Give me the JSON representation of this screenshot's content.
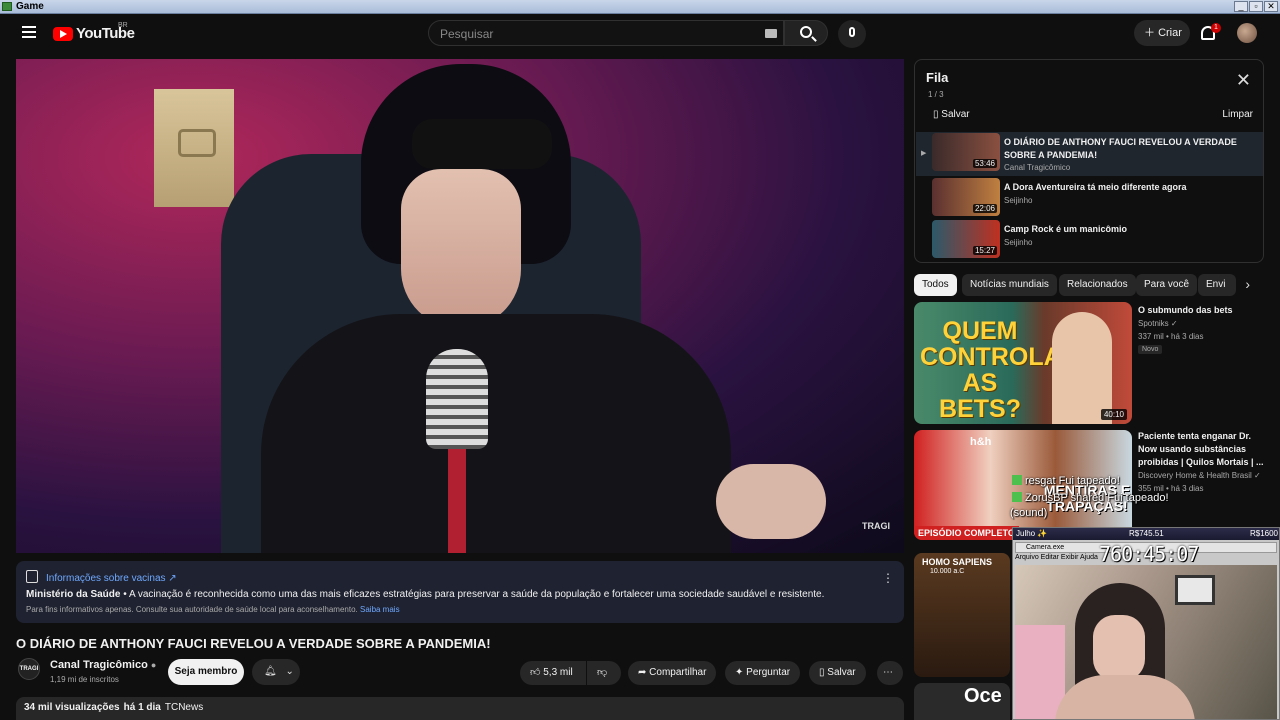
{
  "window": {
    "title": "Game",
    "buttons": [
      "_",
      "▫",
      "✕"
    ]
  },
  "header": {
    "logo_text": "YouTube",
    "logo_country": "BR",
    "search_placeholder": "Pesquisar",
    "create_label": "Criar",
    "notification_count": "1"
  },
  "player": {
    "watermark": "TRAGI"
  },
  "info_panel": {
    "title": "Informações sobre vacinas ↗",
    "source": "Ministério da Saúde",
    "text": " • A vacinação é reconhecida como uma das mais eficazes estratégias para preservar a saúde da população e fortalecer uma sociedade saudável e resistente.",
    "footnote": "Para fins informativos apenas. Consulte sua autoridade de saúde local para aconselhamento.",
    "footnote_link": "Saiba mais"
  },
  "video": {
    "title": "O DIÁRIO DE ANTHONY FAUCI REVELOU A VERDADE SOBRE A PANDEMIA!",
    "channel": "Canal Tragicômico",
    "channel_avatar_text": "TRAGI",
    "subscribers": "1,19 mi de inscritos",
    "member_label": "Seja membro",
    "likes": "5,3 mil",
    "share_label": "Compartilhar",
    "ask_label": "Perguntar",
    "save_label": "Salvar",
    "views": "34 mil visualizações",
    "age": "há 1 dia",
    "tag": "TCNews"
  },
  "queue": {
    "title": "Fila",
    "count": "1 / 3",
    "save_label": "Salvar",
    "clear_label": "Limpar",
    "items": [
      {
        "title": "O DIÁRIO DE ANTHONY FAUCI REVELOU A VERDADE SOBRE A PANDEMIA!",
        "channel": "Canal Tragicômico",
        "duration": "53:46",
        "thumb_color": "#3a2a2a"
      },
      {
        "title": "A Dora Aventureira tá meio diferente agora",
        "channel": "Seijinho",
        "duration": "22:06",
        "thumb_color": "#5a3030"
      },
      {
        "title": "Camp Rock é um manicômio",
        "channel": "Seijinho",
        "duration": "15:27",
        "thumb_color": "#2a5a6a"
      }
    ]
  },
  "chips": [
    "Todos",
    "Notícias mundiais",
    "Relacionados",
    "Para você",
    "Envi"
  ],
  "recommendations": [
    {
      "title": "O submundo das bets",
      "channel": "Spotniks ✓",
      "meta": "337 mil • há 3 dias",
      "badge": "Novo",
      "duration": "40:10",
      "thumb_text": "QUEM CONTROLA AS BETS?"
    },
    {
      "title": "Paciente tenta enganar Dr. Now usando substâncias proibidas | Quilos Mortais | ...",
      "channel": "Discovery Home & Health Brasil ✓",
      "meta": "355 mil • há 3 dias",
      "thumb_text": "MENTIRAS E TRAPAÇAS!",
      "thumb_label": "EPISÓDIO COMPLETO",
      "thumb_logo": "h&h"
    },
    {
      "thumb_text": "HOMO SAPIENS",
      "thumb_sub": "10.000 a.C"
    },
    {
      "thumb_text": "Oce"
    }
  ],
  "stream_chat": [
    {
      "user": "resgat",
      "text": "Fui tapeado!"
    },
    {
      "user": "ZorusBP",
      "text": "shared Fui tapeado!"
    },
    {
      "user": "",
      "text": "(sound)"
    }
  ],
  "stream_overlay": {
    "label": "Julho ✨",
    "left_value": "R$745.51",
    "right_value": "R$1600",
    "camera_label": "Camera.exe",
    "timer": "760:45:07",
    "file_label": "Arquivo  Editar  Exibir  Ajuda"
  }
}
